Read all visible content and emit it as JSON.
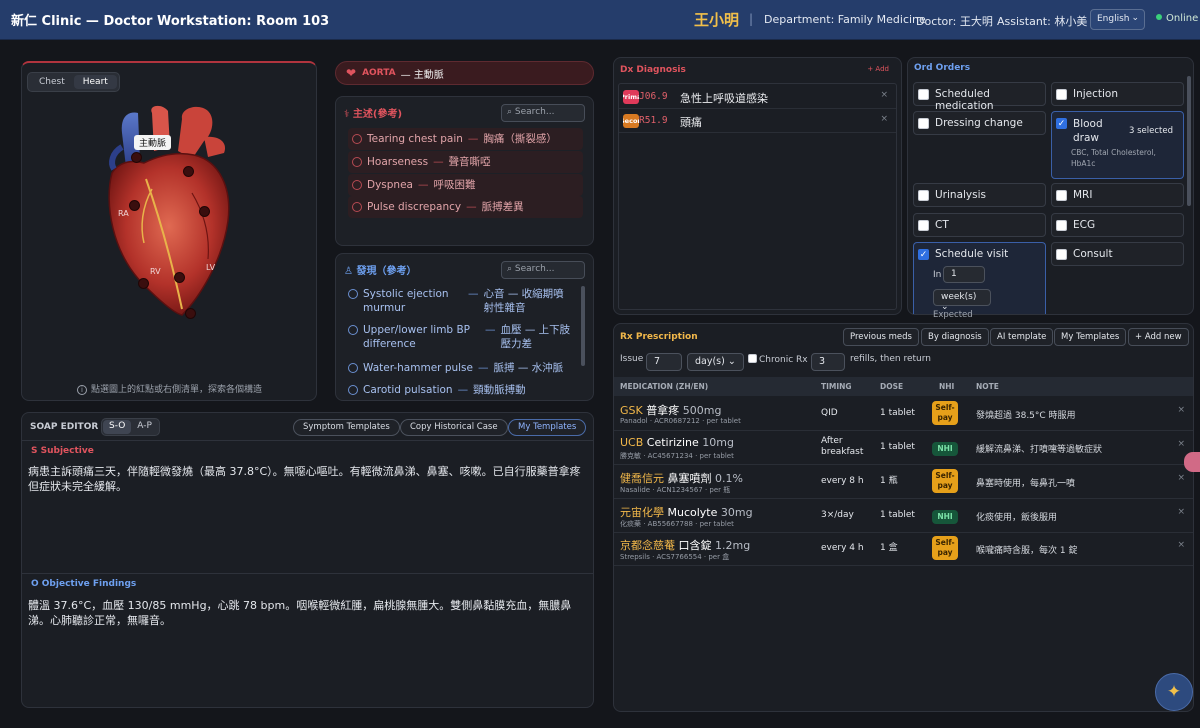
{
  "header": {
    "title": "新仁 Clinic — Doctor Workstation: Room 103",
    "patient": "王小明",
    "separator": "|",
    "department": "Department: Family Medicine",
    "doctor": "Doctor: 王大明",
    "assistant": "Assistant: 林小美",
    "language": "English",
    "status": "Online"
  },
  "anatomy": {
    "tabs": [
      "Chest",
      "Heart"
    ],
    "active_tab": "Heart",
    "aorta_label": "主動脈",
    "chambers": [
      "RA",
      "RV",
      "LV"
    ],
    "hint": "點選圖上的紅點或右側清單，探索各個構造"
  },
  "structure": {
    "name_en": "AORTA",
    "name_zh": "— 主動脈"
  },
  "symptoms": {
    "title": "主述(參考)",
    "search_placeholder": "Search...",
    "items": [
      {
        "en": "Tearing chest pain",
        "zh": "胸痛（撕裂感）"
      },
      {
        "en": "Hoarseness",
        "zh": "聲音嘶啞"
      },
      {
        "en": "Dyspnea",
        "zh": "呼吸困難"
      },
      {
        "en": "Pulse discrepancy",
        "zh": "脈搏差異"
      }
    ]
  },
  "signs": {
    "title": "發現（參考）",
    "search_placeholder": "Search...",
    "items": [
      {
        "en": "Systolic ejection murmur",
        "zh": "心音 — 收縮期噴射性雜音"
      },
      {
        "en": "Upper/lower limb BP difference",
        "zh": "血壓 — 上下肢壓力差"
      },
      {
        "en": "Water-hammer pulse",
        "zh": "脈搏 — 水沖脈"
      },
      {
        "en": "Carotid pulsation",
        "zh": "頸動脈搏動"
      }
    ]
  },
  "soap": {
    "title": "SOAP EDITOR",
    "tabs": [
      "S-O",
      "A-P"
    ],
    "active_tab": "S-O",
    "buttons": [
      "Symptom Templates",
      "Copy Historical Case",
      "My Templates"
    ],
    "subjective_label": "S Subjective",
    "subjective_text": "病患主訴頭痛三天，伴隨輕微發燒（最高 37.8°C）。無噁心嘔吐。有輕微流鼻涕、鼻塞、咳嗽。已自行服藥普拿疼但症狀未完全緩解。",
    "objective_label": "O Objective Findings",
    "objective_text": "體溫 37.6°C，血壓 130/85 mmHg，心跳 78 bpm。咽喉輕微紅腫，扁桃腺無腫大。雙側鼻黏膜充血，無膿鼻涕。心肺聽診正常，無囉音。"
  },
  "diagnosis": {
    "title": "Dx Diagnosis",
    "add_label": "+ Add",
    "items": [
      {
        "badge": "Primary",
        "code": "J06.9",
        "name": "急性上呼吸道感染",
        "remove": "×"
      },
      {
        "badge": "Secondary",
        "code": "R51.9",
        "name": "頭痛",
        "remove": "×"
      }
    ]
  },
  "orders": {
    "title": "Ord Orders",
    "items": [
      {
        "label": "Scheduled medication",
        "checked": false
      },
      {
        "label": "Injection",
        "checked": false
      },
      {
        "label": "Dressing change",
        "checked": false
      },
      {
        "label": "Blood draw",
        "checked": true,
        "selected": "3 selected",
        "sub": "CBC, Total Cholesterol, HbA1c"
      },
      {
        "label": "Urinalysis",
        "checked": false
      },
      {
        "label": "MRI",
        "checked": false
      },
      {
        "label": "CT",
        "checked": false
      },
      {
        "label": "ECG",
        "checked": false
      },
      {
        "label": "Schedule visit",
        "checked": true,
        "in_label": "In",
        "in_value": "1",
        "unit": "week(s)",
        "expected": "Expected"
      },
      {
        "label": "Consult",
        "checked": false
      }
    ]
  },
  "prescription": {
    "title": "Rx Prescription",
    "buttons": [
      "Previous meds",
      "By diagnosis",
      "AI template",
      "My Templates",
      "+ Add new"
    ],
    "issue_label": "Issue",
    "issue_value": "7",
    "issue_unit": "day(s)",
    "chronic_label": "Chronic Rx",
    "refills_value": "3",
    "refills_label": "refills, then return",
    "columns": [
      "MEDICATION (ZH/EN)",
      "TIMING",
      "DOSE",
      "NHI",
      "NOTE"
    ],
    "rows": [
      {
        "brand": "GSK",
        "name": "普拿疼",
        "strength": "500mg",
        "sub": "Panadol · ACR0687212 · per tablet",
        "timing": "QID",
        "dose": "1 tablet",
        "nhi": "Self-pay",
        "nhi_type": "self",
        "note": "發燒超過 38.5°C 時服用"
      },
      {
        "brand": "UCB",
        "name": "Cetirizine",
        "strength": "10mg",
        "sub": "勝克敏 · AC45671234 · per tablet",
        "timing": "After breakfast",
        "dose": "1 tablet",
        "nhi": "NHI",
        "nhi_type": "nhi",
        "note": "緩解流鼻涕、打噴嚏等過敏症狀"
      },
      {
        "brand": "健喬信元",
        "name": "鼻塞噴劑",
        "strength": "0.1%",
        "sub": "Nasalide · ACN1234567 · per 瓶",
        "timing": "every 8 h",
        "dose": "1 瓶",
        "nhi": "Self-pay",
        "nhi_type": "self",
        "note": "鼻塞時使用，每鼻孔一噴"
      },
      {
        "brand": "元宙化學",
        "name": "Mucolyte",
        "strength": "30mg",
        "sub": "化痰藥 · AB55667788 · per tablet",
        "timing": "3×/day",
        "dose": "1 tablet",
        "nhi": "NHI",
        "nhi_type": "nhi",
        "note": "化痰使用，飯後服用"
      },
      {
        "brand": "京都念慈菴",
        "name": "口含錠",
        "strength": "1.2mg",
        "sub": "Strepsils · ACS7766554 · per 盒",
        "timing": "every 4 h",
        "dose": "1 盒",
        "nhi": "Self-pay",
        "nhi_type": "self",
        "note": "喉嚨痛時含服，每次 1 錠"
      }
    ],
    "remove": "×"
  },
  "colors": {
    "header_bg": "#253d6b",
    "patient_name": "#f2c04a",
    "accent_red": "#e0545e",
    "accent_blue": "#6ea0f0",
    "rx_accent": "#f2b84a",
    "online": "#3ad07a"
  },
  "icons": {
    "heart": "heart-icon",
    "symptom": "stethoscope-icon",
    "signs": "person-icon",
    "search": "search-icon",
    "info": "info-icon",
    "assistant": "sparkle-icon"
  }
}
